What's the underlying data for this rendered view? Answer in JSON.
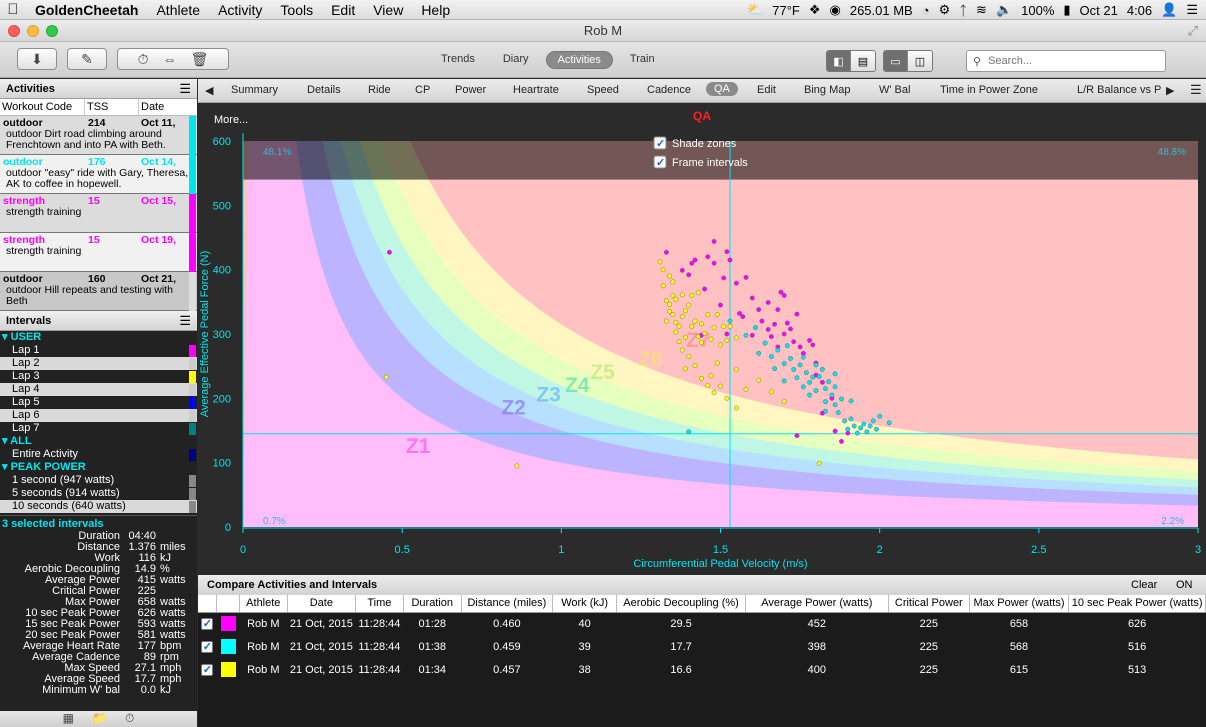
{
  "menubar": {
    "app": "GoldenCheetah",
    "items": [
      "Athlete",
      "Activity",
      "Tools",
      "Edit",
      "View",
      "Help"
    ],
    "status": {
      "weather": "77°F",
      "memory": "265.01 MB",
      "battery": "100%",
      "date": "Oct 21",
      "time": "4:06"
    }
  },
  "window": {
    "title": "Rob M"
  },
  "toolbar": {
    "modes": [
      "Trends",
      "Diary",
      "Activities",
      "Train"
    ],
    "active_mode": "Activities",
    "search_placeholder": "Search..."
  },
  "activities": {
    "title": "Activities",
    "columns": [
      "Workout Code",
      "TSS",
      "Date"
    ],
    "rows": [
      {
        "code": "outdoor",
        "tss": "214",
        "date": "Oct 11,",
        "desc": "outdoor Dirt road climbing around Frenchtown and into PA with Beth.",
        "color": "#00e5ee",
        "code_color": "#000",
        "bg": "#dcdcdc",
        "selected": false
      },
      {
        "code": "outdoor",
        "tss": "176",
        "date": "Oct 14,",
        "desc": "outdoor \"easy\" ride with Gary, Theresa, AK to coffee in hopewell.",
        "color": "#00e5ee",
        "code_color": "#00e5ee",
        "bg": "#f1f1f1",
        "selected": false
      },
      {
        "code": "strength",
        "tss": "15",
        "date": "Oct 15,",
        "desc": "strength training",
        "color": "#ff00ff",
        "code_color": "#ff00ff",
        "bg": "#dcdcdc",
        "selected": false
      },
      {
        "code": "strength",
        "tss": "15",
        "date": "Oct 19,",
        "desc": "strength training",
        "color": "#ff00ff",
        "code_color": "#ff00ff",
        "bg": "#f1f1f1",
        "selected": false
      },
      {
        "code": "outdoor",
        "tss": "160",
        "date": "Oct 21,",
        "desc": "outdoor Hill repeats and testing with Beth",
        "color": "#dddddd",
        "code_color": "#000",
        "bg": "#c8c8c8",
        "selected": true
      }
    ]
  },
  "intervals": {
    "title": "Intervals",
    "user_label": "USER",
    "laps": [
      {
        "name": "Lap 1",
        "color": "#ff00ff"
      },
      {
        "name": "Lap 2",
        "color": "#cccccc"
      },
      {
        "name": "Lap 3",
        "color": "#ffff00"
      },
      {
        "name": "Lap 4",
        "color": "#cccccc"
      },
      {
        "name": "Lap 5",
        "color": "#0000ff"
      },
      {
        "name": "Lap 6",
        "color": "#cccccc"
      },
      {
        "name": "Lap 7",
        "color": "#008080"
      }
    ],
    "all_label": "ALL",
    "entire": "Entire Activity",
    "peak_label": "PEAK POWER",
    "peaks": [
      "1 second (947 watts)",
      "5 seconds (914 watts)",
      "10 seconds (640 watts)"
    ]
  },
  "selected": {
    "title": "3 selected intervals",
    "stats": [
      [
        "Duration",
        "04:40",
        ""
      ],
      [
        "Distance",
        "1.376",
        "miles"
      ],
      [
        "Work",
        "116",
        "kJ"
      ],
      [
        "Aerobic Decoupling",
        "14.9",
        "%"
      ],
      [
        "Average Power",
        "415",
        "watts"
      ],
      [
        "Critical Power",
        "225",
        ""
      ],
      [
        "Max Power",
        "658",
        "watts"
      ],
      [
        "10 sec Peak Power",
        "626",
        "watts"
      ],
      [
        "15 sec Peak Power",
        "593",
        "watts"
      ],
      [
        "20 sec Peak Power",
        "581",
        "watts"
      ],
      [
        "Average Heart Rate",
        "177",
        "bpm"
      ],
      [
        "Average Cadence",
        "89",
        "rpm"
      ],
      [
        "Max Speed",
        "27.1",
        "mph"
      ],
      [
        "Average Speed",
        "17.7",
        "mph"
      ],
      [
        "Minimum W' bal",
        "0.0",
        "kJ"
      ]
    ]
  },
  "tabs": [
    "Summary",
    "Details",
    "Ride",
    "CP",
    "Power",
    "Heartrate",
    "Speed",
    "Cadence",
    "QA",
    "Edit",
    "Bing Map",
    "W' Bal",
    "Time in Power Zone",
    "L/R Balance vs P"
  ],
  "active_tab": "QA",
  "chart_more": "More...",
  "options": {
    "shade_zones": "Shade zones",
    "frame_intervals": "Frame intervals"
  },
  "chart_data": {
    "type": "scatter",
    "title": "QA",
    "xlabel": "Circumferential Pedal Velocity (m/s)",
    "ylabel": "Average Effective Pedal Force (N)",
    "xlim": [
      0,
      3
    ],
    "ylim": [
      0,
      600
    ],
    "xticks": [
      "0",
      "0.5",
      "1",
      "1.5",
      "2",
      "2.5",
      "3"
    ],
    "yticks": [
      "0",
      "100",
      "200",
      "300",
      "400",
      "500",
      "600"
    ],
    "crosshair": {
      "x": 1.53,
      "y": 145
    },
    "zones": [
      "Z1",
      "Z2",
      "Z3",
      "Z4",
      "Z5",
      "Z6",
      "Z7"
    ],
    "zone_powers": [
      100,
      150,
      185,
      220,
      260,
      315
    ],
    "zone_colors": [
      "#ffbdf9",
      "#bcb4ff",
      "#b7e0ff",
      "#bff7e4",
      "#e6ffbf",
      "#fff6c2",
      "#ffc1c1"
    ],
    "quadrant_pct": {
      "top_left": "48.1%",
      "top_right": "48.8%",
      "bottom_left": "0.7%",
      "bottom_right": "2.2%"
    },
    "series": [
      {
        "name": "Lap 1",
        "color": "#ff00ff",
        "points": [
          [
            0.46,
            427
          ],
          [
            1.33,
            427
          ],
          [
            1.38,
            399
          ],
          [
            1.4,
            392
          ],
          [
            1.42,
            415
          ],
          [
            1.45,
            370
          ],
          [
            1.46,
            420
          ],
          [
            1.48,
            444
          ],
          [
            1.48,
            410
          ],
          [
            1.5,
            345
          ],
          [
            1.51,
            387
          ],
          [
            1.52,
            428
          ],
          [
            1.53,
            415
          ],
          [
            1.55,
            379
          ],
          [
            1.56,
            332
          ],
          [
            1.58,
            388
          ],
          [
            1.6,
            356
          ],
          [
            1.62,
            338
          ],
          [
            1.63,
            320
          ],
          [
            1.65,
            307
          ],
          [
            1.65,
            349
          ],
          [
            1.67,
            315
          ],
          [
            1.68,
            338
          ],
          [
            1.7,
            300
          ],
          [
            1.7,
            360
          ],
          [
            1.72,
            308
          ],
          [
            1.73,
            288
          ],
          [
            1.74,
            331
          ],
          [
            1.75,
            280
          ],
          [
            1.76,
            270
          ],
          [
            1.78,
            290
          ],
          [
            1.8,
            255
          ],
          [
            1.8,
            236
          ],
          [
            1.82,
            225
          ],
          [
            1.82,
            177
          ],
          [
            1.85,
            200
          ],
          [
            1.86,
            149
          ],
          [
            1.88,
            133
          ],
          [
            1.9,
            146
          ],
          [
            1.74,
            142
          ],
          [
            1.71,
            317
          ],
          [
            1.69,
            365
          ],
          [
            1.6,
            298
          ],
          [
            1.41,
            410
          ],
          [
            1.44,
            298
          ],
          [
            1.52,
            300
          ],
          [
            1.57,
            327
          ],
          [
            1.66,
            296
          ],
          [
            1.68,
            280
          ],
          [
            1.79,
            283
          ]
        ]
      },
      {
        "name": "Lap 3",
        "color": "#ffff00",
        "points": [
          [
            0.45,
            233
          ],
          [
            0.86,
            95
          ],
          [
            1.31,
            412
          ],
          [
            1.32,
            400
          ],
          [
            1.33,
            352
          ],
          [
            1.34,
            346
          ],
          [
            1.34,
            335
          ],
          [
            1.35,
            381
          ],
          [
            1.35,
            330
          ],
          [
            1.36,
            318
          ],
          [
            1.36,
            354
          ],
          [
            1.37,
            312
          ],
          [
            1.38,
            327
          ],
          [
            1.38,
            361
          ],
          [
            1.39,
            336
          ],
          [
            1.39,
            295
          ],
          [
            1.4,
            345
          ],
          [
            1.41,
            312
          ],
          [
            1.41,
            360
          ],
          [
            1.42,
            320
          ],
          [
            1.43,
            296
          ],
          [
            1.43,
            364
          ],
          [
            1.44,
            287
          ],
          [
            1.44,
            316
          ],
          [
            1.45,
            301
          ],
          [
            1.46,
            330
          ],
          [
            1.47,
            292
          ],
          [
            1.48,
            310
          ],
          [
            1.49,
            330
          ],
          [
            1.5,
            283
          ],
          [
            1.51,
            312
          ],
          [
            1.52,
            290
          ],
          [
            1.53,
            312
          ],
          [
            1.55,
            294
          ],
          [
            1.36,
            303
          ],
          [
            1.37,
            288
          ],
          [
            1.38,
            275
          ],
          [
            1.4,
            265
          ],
          [
            1.42,
            251
          ],
          [
            1.44,
            231
          ],
          [
            1.46,
            220
          ],
          [
            1.48,
            209
          ],
          [
            1.5,
            219
          ],
          [
            1.52,
            200
          ],
          [
            1.55,
            185
          ],
          [
            1.58,
            214
          ],
          [
            1.62,
            228
          ],
          [
            1.66,
            210
          ],
          [
            1.7,
            195
          ],
          [
            1.55,
            245
          ],
          [
            1.49,
            255
          ],
          [
            1.47,
            235
          ],
          [
            1.39,
            246
          ],
          [
            1.33,
            320
          ],
          [
            1.32,
            375
          ],
          [
            1.34,
            390
          ],
          [
            1.35,
            360
          ],
          [
            1.81,
            99
          ]
        ]
      },
      {
        "name": "Lap 7",
        "color": "#00e5ee",
        "points": [
          [
            1.4,
            148
          ],
          [
            1.53,
            320
          ],
          [
            1.58,
            298
          ],
          [
            1.61,
            310
          ],
          [
            1.64,
            286
          ],
          [
            1.66,
            265
          ],
          [
            1.68,
            275
          ],
          [
            1.7,
            254
          ],
          [
            1.71,
            282
          ],
          [
            1.72,
            262
          ],
          [
            1.73,
            245
          ],
          [
            1.74,
            232
          ],
          [
            1.75,
            252
          ],
          [
            1.76,
            264
          ],
          [
            1.77,
            240
          ],
          [
            1.78,
            225
          ],
          [
            1.79,
            233
          ],
          [
            1.8,
            252
          ],
          [
            1.8,
            212
          ],
          [
            1.81,
            234
          ],
          [
            1.82,
            245
          ],
          [
            1.83,
            215
          ],
          [
            1.83,
            195
          ],
          [
            1.84,
            226
          ],
          [
            1.85,
            205
          ],
          [
            1.86,
            190
          ],
          [
            1.86,
            218
          ],
          [
            1.87,
            178
          ],
          [
            1.88,
            199
          ],
          [
            1.89,
            165
          ],
          [
            1.9,
            152
          ],
          [
            1.91,
            168
          ],
          [
            1.92,
            157
          ],
          [
            1.93,
            146
          ],
          [
            1.94,
            154
          ],
          [
            1.95,
            160
          ],
          [
            1.96,
            148
          ],
          [
            1.97,
            157
          ],
          [
            1.98,
            165
          ],
          [
            1.99,
            152
          ],
          [
            2.0,
            172
          ],
          [
            2.03,
            162
          ],
          [
            1.7,
            227
          ],
          [
            1.76,
            218
          ],
          [
            1.67,
            246
          ],
          [
            1.78,
            205
          ],
          [
            1.86,
            238
          ],
          [
            1.91,
            196
          ],
          [
            1.83,
            180
          ],
          [
            1.62,
            270
          ]
        ]
      }
    ]
  },
  "compare": {
    "title": "Compare Activities and Intervals",
    "clear": "Clear",
    "on": "ON",
    "columns": [
      "",
      "",
      "Athlete",
      "Date",
      "Time",
      "Duration",
      "Distance (miles)",
      "Work (kJ)",
      "Aerobic Decoupling (%)",
      "Average Power (watts)",
      "Critical Power",
      "Max Power (watts)",
      "10 sec Peak Power (watts)"
    ],
    "rows": [
      {
        "checked": true,
        "color": "#ff00ff",
        "cells": [
          "Rob M",
          "21 Oct, 2015",
          "11:28:44",
          "01:28",
          "0.460",
          "40",
          "29.5",
          "452",
          "225",
          "658",
          "626"
        ]
      },
      {
        "checked": true,
        "color": "#00ffff",
        "cells": [
          "Rob M",
          "21 Oct, 2015",
          "11:28:44",
          "01:38",
          "0.459",
          "39",
          "17.7",
          "398",
          "225",
          "568",
          "516"
        ]
      },
      {
        "checked": true,
        "color": "#ffff00",
        "cells": [
          "Rob M",
          "21 Oct, 2015",
          "11:28:44",
          "01:34",
          "0.457",
          "38",
          "16.6",
          "400",
          "225",
          "615",
          "513"
        ]
      }
    ]
  }
}
